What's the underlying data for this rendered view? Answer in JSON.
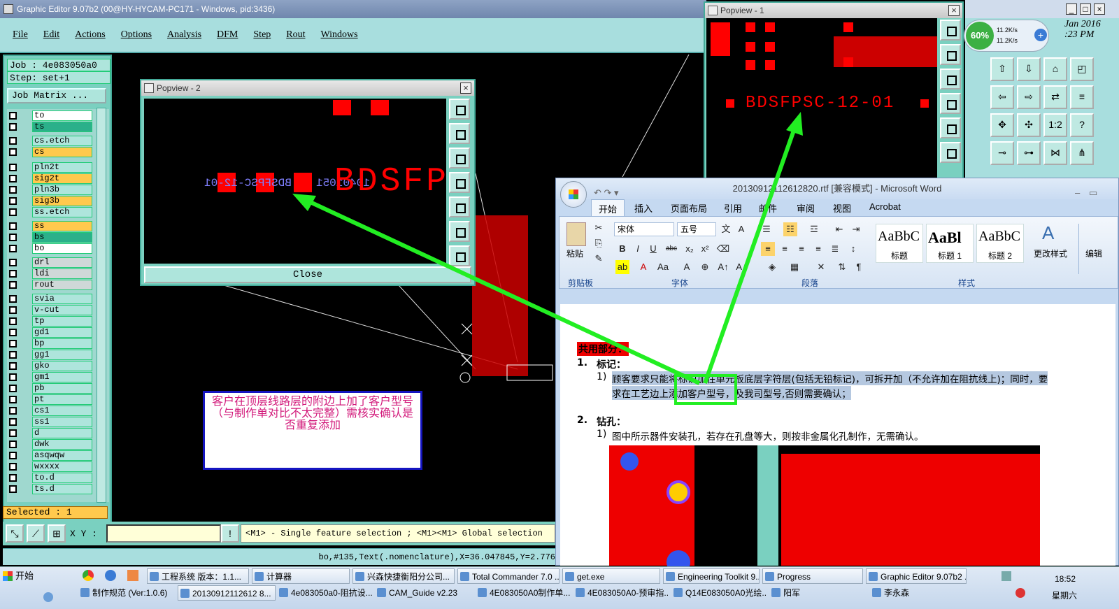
{
  "graphic_editor": {
    "title": "Graphic Editor 9.07b2 (00@HY-HYCAM-PC171 - Windows, pid:3436)",
    "menu": [
      "File",
      "Edit",
      "Actions",
      "Options",
      "Analysis",
      "DFM",
      "Step",
      "Rout",
      "Windows"
    ],
    "job": "Job : 4e083050a0",
    "step": "Step: set+1",
    "job_matrix": "Job Matrix ...",
    "layers": [
      {
        "name": "to",
        "color": "white"
      },
      {
        "name": "ts",
        "color": "green"
      },
      {
        "name": "cs.etch",
        "color": "plain"
      },
      {
        "name": "cs",
        "color": "orange"
      },
      {
        "name": "pln2t",
        "color": "plain"
      },
      {
        "name": "sig2t",
        "color": "orange"
      },
      {
        "name": "pln3b",
        "color": "plain"
      },
      {
        "name": "sig3b",
        "color": "orange"
      },
      {
        "name": "ss.etch",
        "color": "plain"
      },
      {
        "name": "ss",
        "color": "orange"
      },
      {
        "name": "bs",
        "color": "green"
      },
      {
        "name": "bo",
        "color": "white"
      },
      {
        "name": "drl",
        "color": "grey"
      },
      {
        "name": "ldi",
        "color": "grey"
      },
      {
        "name": "rout",
        "color": "grey"
      },
      {
        "name": "svia",
        "color": "plain"
      },
      {
        "name": "v-cut",
        "color": "plain"
      },
      {
        "name": "tp",
        "color": "plain"
      },
      {
        "name": "gd1",
        "color": "plain"
      },
      {
        "name": "bp",
        "color": "plain"
      },
      {
        "name": "gg1",
        "color": "plain"
      },
      {
        "name": "gko",
        "color": "plain"
      },
      {
        "name": "gm1",
        "color": "plain"
      },
      {
        "name": "pb",
        "color": "plain"
      },
      {
        "name": "pt",
        "color": "plain"
      },
      {
        "name": "cs1",
        "color": "plain"
      },
      {
        "name": "ss1",
        "color": "plain"
      },
      {
        "name": "d",
        "color": "plain"
      },
      {
        "name": "dwk",
        "color": "plain"
      },
      {
        "name": "asqwqw",
        "color": "plain"
      },
      {
        "name": "wxxxx",
        "color": "plain"
      },
      {
        "name": "to.d",
        "color": "plain"
      },
      {
        "name": "ts.d",
        "color": "plain"
      }
    ],
    "selected": "Selected : 1",
    "xy_label": "X Y :",
    "hint": "<M1> - Single feature selection ; <M1><M1> Global selection",
    "status": "bo,#135,Text(.nomenclature),X=36.047845,Y=2.776"
  },
  "popview2": {
    "title": "Popview - 2",
    "close_button": "Close",
    "text_mirrored": "BDSFPSC-12-01",
    "text_code": "10401051",
    "text_big": "BDSFP"
  },
  "popview1": {
    "title": "Popview - 1",
    "text": "BDSFPSC-12-01"
  },
  "tray_widget": {
    "percent": "60%",
    "up": "11.2K/s",
    "down": "11.2K/s",
    "date_fragment": "Jan 2016",
    "time_fragment": ":23 PM"
  },
  "word": {
    "title": "20130912112612820.rtf [兼容模式] - Microsoft Word",
    "tabs": [
      "开始",
      "插入",
      "页面布局",
      "引用",
      "邮件",
      "审阅",
      "视图",
      "Acrobat"
    ],
    "font": "宋体",
    "size": "五号",
    "groups": [
      "剪贴板",
      "字体",
      "段落",
      "样式",
      "编辑"
    ],
    "paste": "粘贴",
    "styles": [
      {
        "sample": "AaBbC",
        "name": "标题"
      },
      {
        "sample": "AaBl",
        "name": "标题 1"
      },
      {
        "sample": "AaBbC",
        "name": "标题 2"
      }
    ],
    "change_style": "更改样式",
    "doc": {
      "section": "共用部分：",
      "item1_no": "1.",
      "item1_title": "标记：",
      "item1_sub": "1)",
      "item1_line1": "顾客要求只能将标识加在单元板底层字符层(包括无铅标记)，可拆开加（不允许加在阻抗线上)；同时，要",
      "item1_line2": "求在工艺边上添加客户型号，及我司型号,否则需要确认；",
      "item2_no": "2.",
      "item2_title": "钻孔：",
      "item2_sub": "1)",
      "item2_line1": "图中所示器件安装孔，若存在孔盘等大，则按非金属化孔制作，无需确认。"
    }
  },
  "note": {
    "text": "客户在顶层线路层的附边上加了客户型号（与制作单对比不太完整）需核实确认是否重复添加"
  },
  "taskbar": {
    "start": "开始",
    "row1": [
      "工程系统  版本：1.1...",
      "计算器",
      "兴森快捷衡阳分公司...",
      "Total Commander 7.0 ...",
      "get.exe",
      "Engineering Toolkit 9....",
      "Progress",
      "Graphic Editor 9.07b2 ..."
    ],
    "row2": [
      "制作规范 (Ver:1.0.6)",
      "20130912112612 8...",
      "4e083050a0-阻抗设...",
      "CAM_Guide v2.23",
      "4E083050A0制作单...",
      "4E083050A0-预审指...",
      "Q14E083050A0光绘...",
      "阳军",
      "李永森"
    ],
    "time": "18:52",
    "day": "星期六"
  },
  "colors": {
    "panel_teal": "#7ad0c0",
    "menu_teal": "#a8dede",
    "feature_red": "#ff0000",
    "mirror_text": "#8080ff",
    "annotation_green": "#22ee22",
    "note_text": "#d2187a"
  }
}
